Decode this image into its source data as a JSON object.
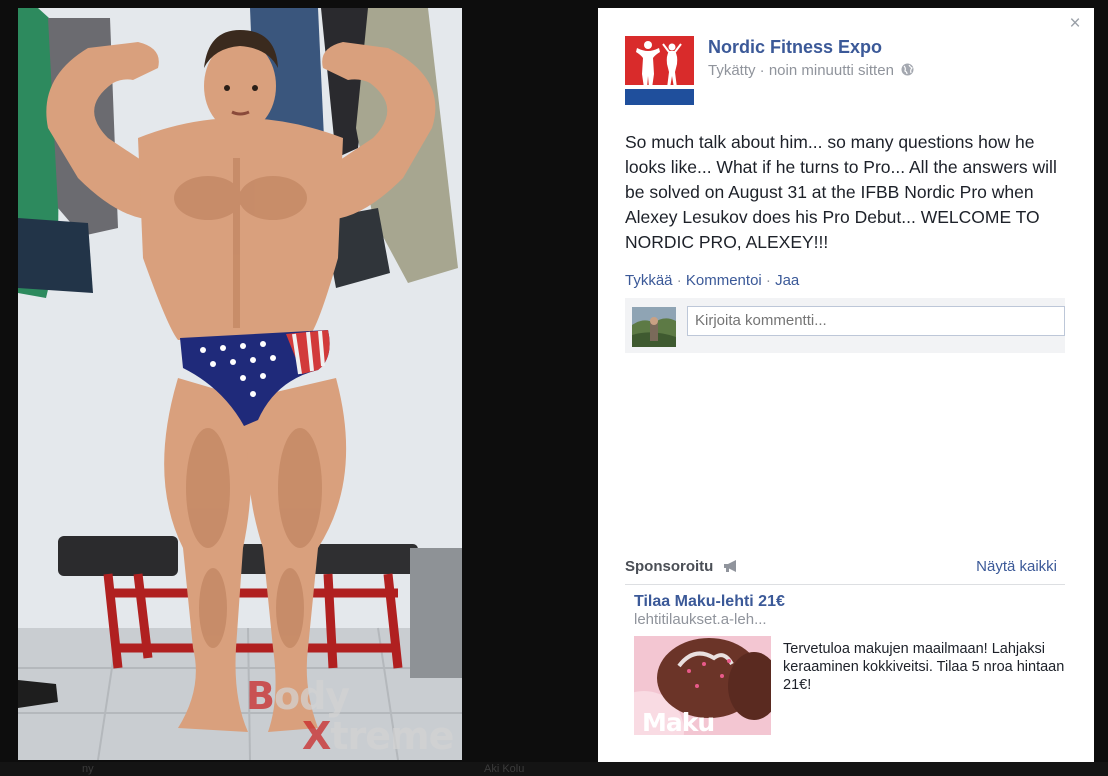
{
  "post": {
    "page_name": "Nordic Fitness Expo",
    "meta": "Tykätty · noin minuutti sitten",
    "text": "So much talk about him... so many questions how he looks like... What if he turns to Pro... All the answers will be solved on August 31 at the IFBB Nordic Pro when Alexey Lesukov does his Pro Debut... WELCOME TO NORDIC PRO, ALEXEY!!!",
    "actions": {
      "like": "Tykkää",
      "comment": "Kommentoi",
      "share": "Jaa",
      "separator": "·"
    },
    "comment_placeholder": "Kirjoita kommentti...",
    "close_glyph": "×"
  },
  "sponsored": {
    "label": "Sponsoroitu",
    "see_all": "Näytä kaikki",
    "ad": {
      "title": "Tilaa Maku-lehti 21€",
      "url": "lehtitilaukset.a-leh...",
      "body": "Tervetuloa makujen maailmaan! Lahjaksi keraaminen kokkiveitsi. Tilaa 5 nroa hintaan 21€!",
      "image_text": "Maku"
    }
  },
  "photo": {
    "watermark_red_1": "B",
    "watermark_rest_1": "ody",
    "watermark_red_2": "X",
    "watermark_rest_2": "treme"
  },
  "background": {
    "ghost_text_left": "ny",
    "ghost_text_mid": "Aki Kolu"
  },
  "icons": {
    "close": "close-icon",
    "globe": "globe-icon",
    "megaphone": "megaphone-icon",
    "logo": "nordic-fitness-expo-logo"
  },
  "colors": {
    "link": "#3b5998",
    "secondary_text": "#90949c",
    "body_text": "#1d2129",
    "panel_bg": "#ffffff",
    "lightbox_bg": "#0d0d0d"
  }
}
